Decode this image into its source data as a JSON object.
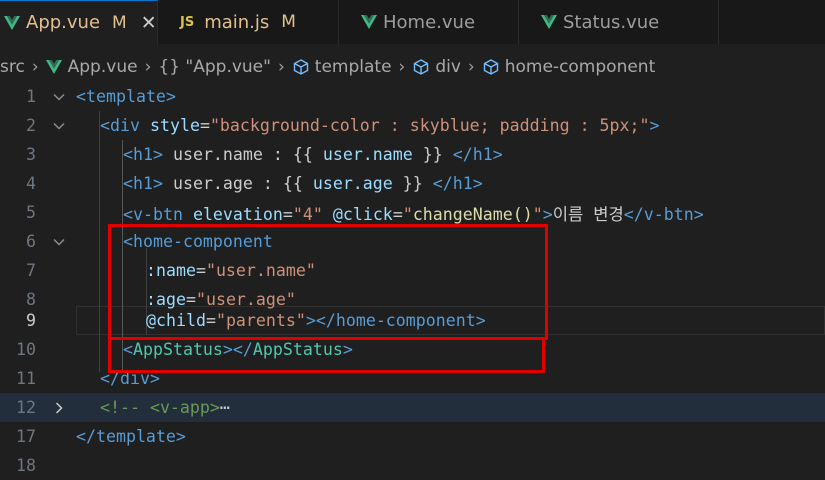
{
  "tabs": [
    {
      "label": "App.vue",
      "modified": "M",
      "icon": "vue-icon",
      "active": true
    },
    {
      "label": "main.js",
      "modified": "M",
      "icon": "js-icon",
      "icon_text": "JS"
    },
    {
      "label": "Home.vue",
      "icon": "vue-icon"
    },
    {
      "label": "Status.vue",
      "icon": "vue-icon"
    }
  ],
  "close_glyph": "✕",
  "breadcrumb": {
    "items": [
      "src",
      "App.vue",
      "{} \"App.vue\"",
      "template",
      "div",
      "home-component"
    ]
  },
  "lines": [
    {
      "num": "1"
    },
    {
      "num": "2"
    },
    {
      "num": "3"
    },
    {
      "num": "4"
    },
    {
      "num": "5"
    },
    {
      "num": "6"
    },
    {
      "num": "7"
    },
    {
      "num": "8"
    },
    {
      "num": "9"
    },
    {
      "num": "10"
    },
    {
      "num": "11"
    },
    {
      "num": "12"
    },
    {
      "num": "17"
    },
    {
      "num": "18"
    }
  ],
  "code": {
    "l1": {
      "open": "<",
      "tag": "template",
      "close": ">"
    },
    "l2": {
      "open": "<",
      "tag": "div",
      "attr": "style",
      "eq": "=",
      "val": "\"background-color : skyblue; padding : 5px;\"",
      "close": ">"
    },
    "l3": {
      "open": "<",
      "tag": "h1",
      "text_a": " user.name : {{ ",
      "expr": "user.name",
      "text_b": " }} ",
      "close_tag": "</h1>"
    },
    "l4": {
      "open": "<",
      "tag": "h1",
      "text_a": " user.age : {{ ",
      "expr": "user.age",
      "text_b": " }} ",
      "close_tag": "</h1>"
    },
    "l5": {
      "open": "<",
      "tag": "v-btn",
      "attr1": "elevation",
      "val1": "\"4\"",
      "attr2": "@click",
      "val2a": "\"",
      "val2b": "changeName()",
      "val2c": "\"",
      "inner": "이름 변경",
      "close_tag": "</v-btn>"
    },
    "l6": {
      "open": "<",
      "tag": "home-component"
    },
    "l7": {
      "attr": ":name",
      "val": "\"user.name\""
    },
    "l8": {
      "attr": ":age",
      "val": "\"user.age\""
    },
    "l9": {
      "attr": "@child",
      "val": "\"parents\"",
      "close_tag": "</home-component>"
    },
    "l10": {
      "open": "<",
      "comp": "AppStatus",
      "mid": "></",
      "comp2": "AppStatus",
      "close": ">"
    },
    "l11": {
      "close_tag": "</div>"
    },
    "l12": {
      "comment": "<!-- <v-app>",
      "ellipsis": "⋯"
    },
    "l17": {
      "close_tag": "</template>"
    }
  }
}
